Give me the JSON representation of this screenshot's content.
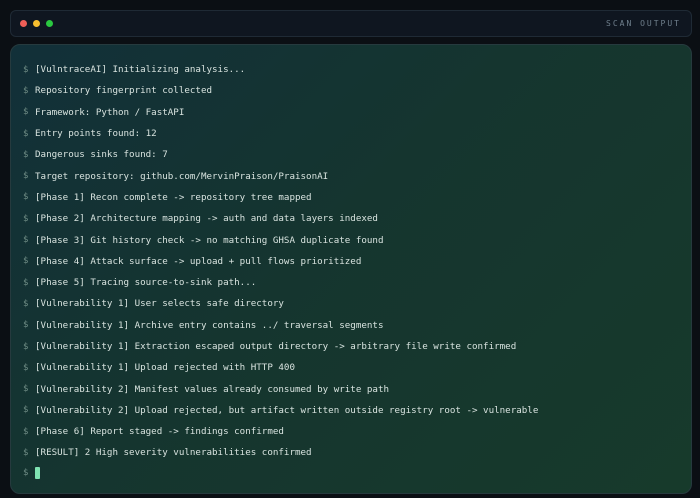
{
  "window": {
    "title": "SCAN OUTPUT"
  },
  "terminal": {
    "prompt_symbol": "$",
    "lines": [
      "[VulntraceAI] Initializing analysis...",
      "Repository fingerprint collected",
      "Framework: Python / FastAPI",
      "Entry points found: 12",
      "Dangerous sinks found: 7",
      "Target repository: github.com/MervinPraison/PraisonAI",
      "[Phase 1] Recon complete -> repository tree mapped",
      "[Phase 2] Architecture mapping -> auth and data layers indexed",
      "[Phase 3] Git history check -> no matching GHSA duplicate found",
      "[Phase 4] Attack surface -> upload + pull flows prioritized",
      "[Phase 5] Tracing source-to-sink path...",
      "[Vulnerability 1] User selects safe directory",
      "[Vulnerability 1] Archive entry contains ../ traversal segments",
      "[Vulnerability 1] Extraction escaped output directory -> arbitrary file write confirmed",
      "[Vulnerability 1] Upload rejected with HTTP 400",
      "[Vulnerability 2] Manifest values already consumed by write path",
      "[Vulnerability 2] Upload rejected, but artifact written outside registry root -> vulnerable",
      "[Phase 6] Report staged -> findings confirmed",
      "[RESULT] 2 High severity vulnerabilities confirmed"
    ]
  },
  "colors": {
    "background": "#0b0f14",
    "panel_start": "#123039",
    "panel_end": "#173a2b",
    "text": "#d8e3df",
    "cursor": "#7fe3b2"
  }
}
